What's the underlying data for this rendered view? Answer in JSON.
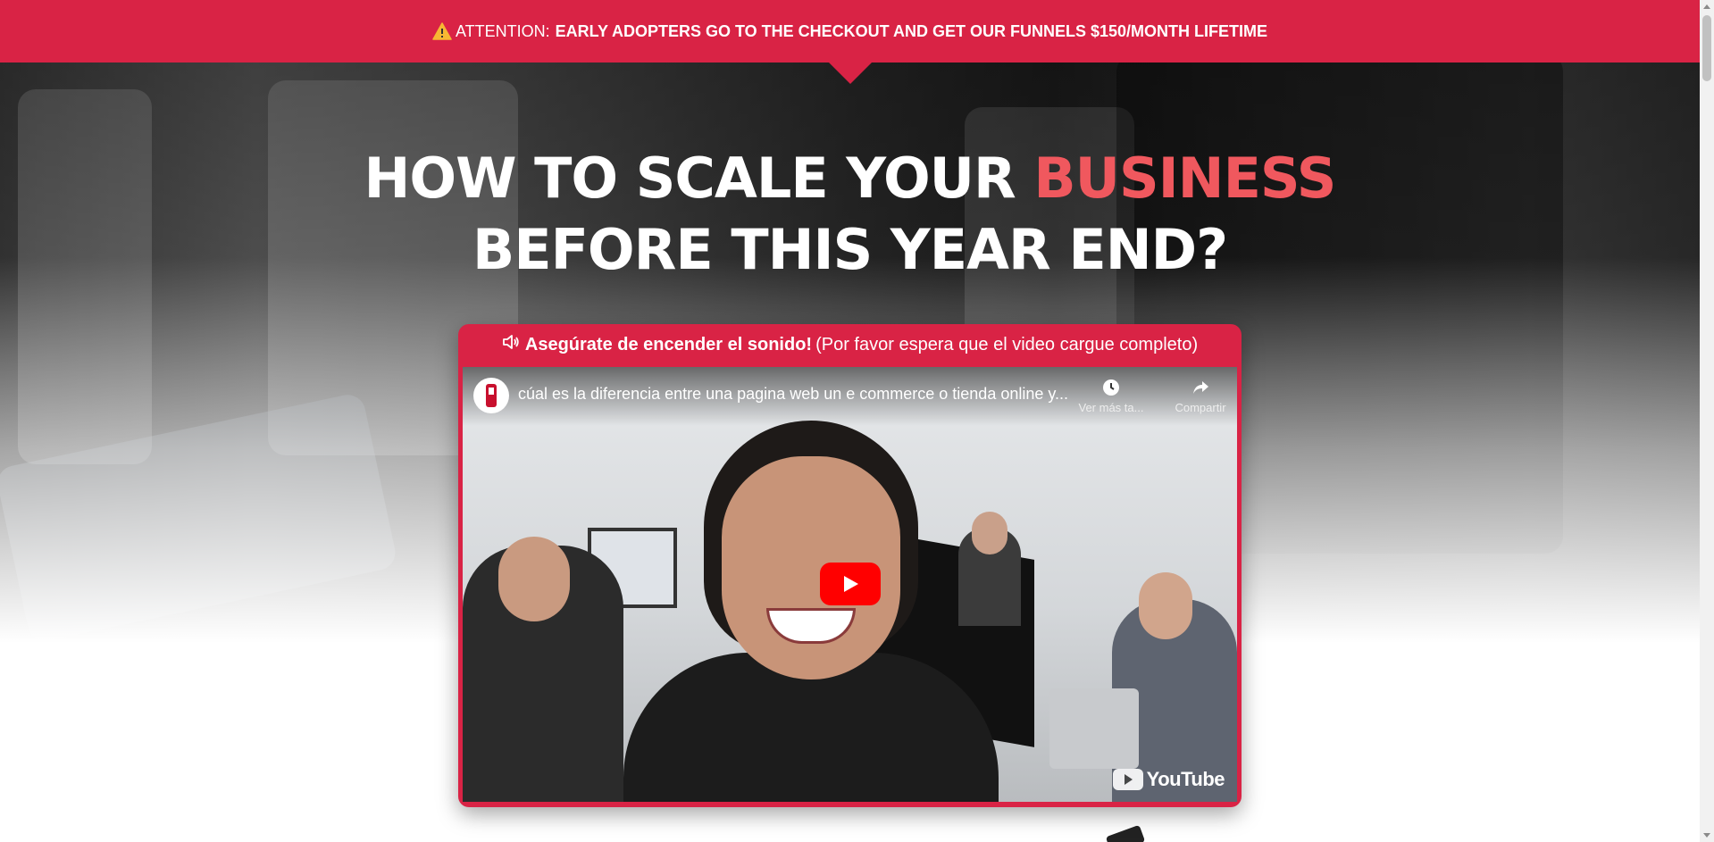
{
  "colors": {
    "brand_red": "#d92345",
    "accent": "#f0585e",
    "youtube_red": "#ff0000"
  },
  "attention_bar": {
    "icon": "warning-icon",
    "label": "ATTENTION:",
    "message": "EARLY ADOPTERS GO TO THE CHECKOUT AND GET OUR FUNNELS $150/MONTH LIFETIME"
  },
  "headline": {
    "part1": "HOW TO SCALE YOUR",
    "highlight": "BUSINESS",
    "line2": "BEFORE THIS YEAR END?"
  },
  "video_card": {
    "sound_icon": "speaker-icon",
    "sound_bold": "Asegúrate de encender el sonido!",
    "sound_note": "(Por favor espera que el video cargue completo)",
    "player": {
      "title": "cúal es la diferencia entre una pagina web un e commerce o tienda online y...",
      "watch_later_label": "Ver más ta...",
      "share_label": "Compartir",
      "logo_text": "YouTube"
    }
  }
}
